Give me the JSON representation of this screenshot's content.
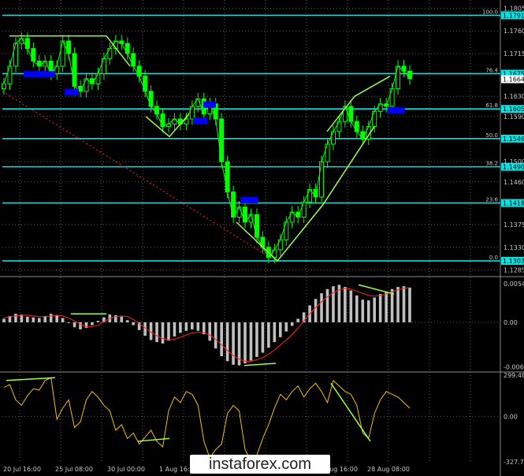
{
  "colors": {
    "background": "#000000",
    "grid": "#5f5f5f",
    "text": "#c8c8c8",
    "fib_line": "#00e5e5",
    "candle": "#00ff00",
    "trend": "#9cff40",
    "signal": "#ff2020",
    "histogram": "#c0c0c0",
    "cci": "#f0c000",
    "box": "#0000ff",
    "price_label_bg": "#00e5e5"
  },
  "watermark": "instaforex.com",
  "chart_data": [
    {
      "type": "candlestick",
      "panel": "price",
      "ylim": [
        1.1278,
        1.1812
      ],
      "y_ticks": [
        "1.1805",
        "1.1760",
        "1.1715",
        "1.1630",
        "1.1590",
        "1.1500",
        "1.1460",
        "1.1375",
        "1.1330",
        "1.1285"
      ],
      "x_labels": [
        "20 Jul 16:00",
        "25 Jul 08:00",
        "30 Jul 00:00",
        "1 Aug 16:00",
        "6 Aug 08:00",
        "1 Aug 00:00",
        "23 Aug 16:00",
        "28 Aug 08:00"
      ],
      "fib_levels": [
        {
          "label": "100.0",
          "price": "1.1791"
        },
        {
          "label": "76.4",
          "price": "1.1675"
        },
        {
          "label": "61.8",
          "price": "1.1605"
        },
        {
          "label": "50.0",
          "price": "1.1546"
        },
        {
          "label": "38.2",
          "price": "1.1490"
        },
        {
          "label": "23.6",
          "price": "1.1418"
        },
        {
          "label": "0.0",
          "price": "1.1303"
        }
      ],
      "current_price": "1.1664",
      "close_series": [
        1.1655,
        1.169,
        1.1735,
        1.1745,
        1.1725,
        1.17,
        1.169,
        1.17,
        1.1675,
        1.169,
        1.174,
        1.1715,
        1.165,
        1.164,
        1.1665,
        1.1655,
        1.1675,
        1.1705,
        1.1725,
        1.174,
        1.1735,
        1.1715,
        1.169,
        1.167,
        1.164,
        1.161,
        1.1595,
        1.157,
        1.1575,
        1.1585,
        1.1575,
        1.1585,
        1.161,
        1.1625,
        1.1595,
        1.1615,
        1.1585,
        1.15,
        1.144,
        1.139,
        1.141,
        1.138,
        1.1395,
        1.135,
        1.133,
        1.131,
        1.1325,
        1.1345,
        1.138,
        1.14,
        1.139,
        1.142,
        1.1445,
        1.143,
        1.15,
        1.1535,
        1.156,
        1.158,
        1.161,
        1.158,
        1.156,
        1.1545,
        1.157,
        1.16,
        1.1615,
        1.161,
        1.1645,
        1.169,
        1.168,
        1.1665
      ]
    },
    {
      "type": "histogram",
      "panel": "MACD",
      "y_ticks": [
        "0.00548",
        "0.00",
        "-0.00628"
      ],
      "ylim": [
        -0.0068,
        0.0059
      ],
      "values": [
        0.0005,
        0.0009,
        0.0012,
        0.0011,
        0.0008,
        0.0007,
        0.0006,
        0.0009,
        0.0012,
        0.001,
        0.0006,
        -0.0001,
        -0.0007,
        -0.001,
        -0.0008,
        -0.0004,
        0.0002,
        0.0007,
        0.0011,
        0.001,
        0.0008,
        0.0003,
        -0.0004,
        -0.0011,
        -0.0019,
        -0.0025,
        -0.0028,
        -0.003,
        -0.0026,
        -0.002,
        -0.0015,
        -0.0012,
        -0.001,
        -0.0012,
        -0.0017,
        -0.0026,
        -0.0037,
        -0.0048,
        -0.0055,
        -0.006,
        -0.0061,
        -0.0058,
        -0.0054,
        -0.0049,
        -0.0043,
        -0.0036,
        -0.0028,
        -0.0021,
        -0.0013,
        -0.0005,
        0.0005,
        0.0014,
        0.0024,
        0.0033,
        0.0041,
        0.0047,
        0.0051,
        0.0053,
        0.005,
        0.0045,
        0.0038,
        0.0032,
        0.0031,
        0.0035,
        0.004,
        0.0043,
        0.0047,
        0.005,
        0.0051,
        0.0049
      ],
      "signal": [
        0.0006,
        0.0008,
        0.0009,
        0.001,
        0.001,
        0.0009,
        0.0008,
        0.0008,
        0.0009,
        0.001,
        0.0009,
        0.0006,
        0.0002,
        -0.0003,
        -0.0006,
        -0.0006,
        -0.0004,
        0.0001,
        0.0005,
        0.0008,
        0.0009,
        0.0008,
        0.0004,
        -0.0002,
        -0.0008,
        -0.0014,
        -0.0019,
        -0.0023,
        -0.0025,
        -0.0024,
        -0.0021,
        -0.0018,
        -0.0015,
        -0.0014,
        -0.0015,
        -0.0018,
        -0.0024,
        -0.0032,
        -0.004,
        -0.0047,
        -0.0052,
        -0.0055,
        -0.0055,
        -0.0053,
        -0.005,
        -0.0045,
        -0.0039,
        -0.0032,
        -0.0025,
        -0.0017,
        -0.0008,
        0.0002,
        0.0012,
        0.0021,
        0.0029,
        0.0036,
        0.0042,
        0.0046,
        0.0048,
        0.0047,
        0.0044,
        0.0041,
        0.0038,
        0.0037,
        0.0038,
        0.004,
        0.0043,
        0.0046,
        0.0048,
        0.0049
      ]
    },
    {
      "type": "line",
      "panel": "CCI",
      "y_ticks": [
        "299.482",
        "0.00",
        "-327.725"
      ],
      "ylim": [
        -340,
        310
      ],
      "values": [
        210,
        230,
        120,
        80,
        150,
        200,
        190,
        260,
        280,
        -20,
        60,
        120,
        -80,
        -40,
        120,
        180,
        140,
        80,
        40,
        -100,
        -60,
        -160,
        -120,
        -200,
        -150,
        -100,
        -180,
        -220,
        40,
        140,
        100,
        180,
        160,
        80,
        -180,
        -300,
        -240,
        -200,
        20,
        80,
        40,
        -240,
        -320,
        -280,
        -160,
        -60,
        60,
        160,
        120,
        180,
        220,
        140,
        200,
        240,
        180,
        100,
        260,
        220,
        180,
        160,
        80,
        -120,
        -160,
        20,
        120,
        180,
        160,
        140,
        100,
        60
      ]
    }
  ]
}
